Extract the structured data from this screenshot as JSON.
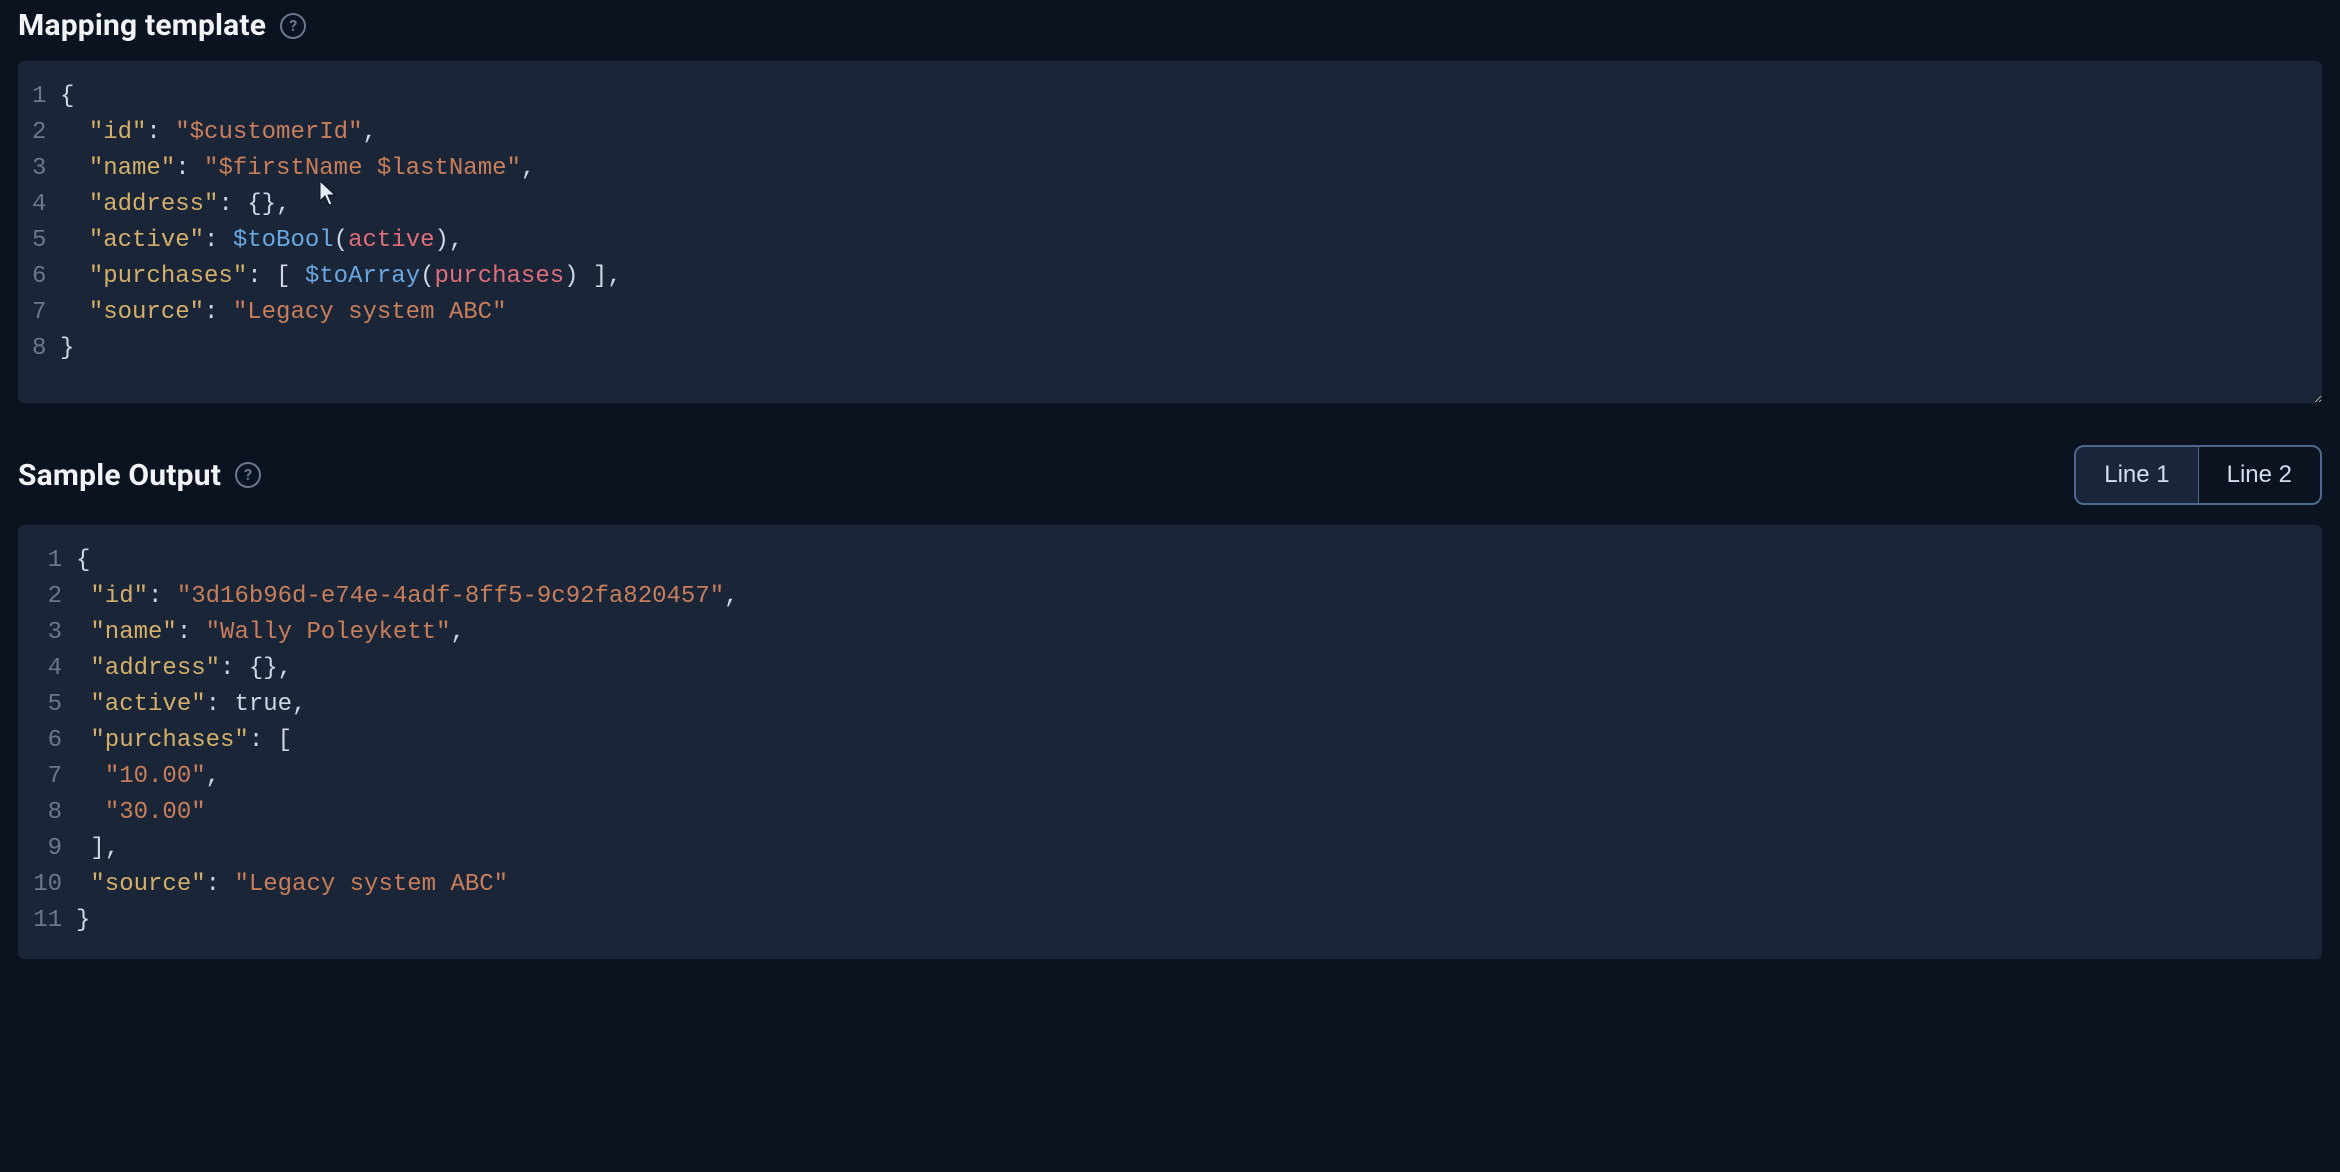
{
  "mappingTemplate": {
    "title": "Mapping template",
    "lines": [
      {
        "n": "1",
        "tokens": [
          {
            "t": "{",
            "c": "punc"
          }
        ]
      },
      {
        "n": "2",
        "tokens": [
          {
            "t": "  ",
            "c": "plain"
          },
          {
            "t": "\"id\"",
            "c": "key"
          },
          {
            "t": ": ",
            "c": "punc"
          },
          {
            "t": "\"$customerId\"",
            "c": "str"
          },
          {
            "t": ",",
            "c": "punc"
          }
        ]
      },
      {
        "n": "3",
        "tokens": [
          {
            "t": "  ",
            "c": "plain"
          },
          {
            "t": "\"name\"",
            "c": "key"
          },
          {
            "t": ": ",
            "c": "punc"
          },
          {
            "t": "\"$firstName $lastName\"",
            "c": "str"
          },
          {
            "t": ",",
            "c": "punc"
          }
        ]
      },
      {
        "n": "4",
        "tokens": [
          {
            "t": "  ",
            "c": "plain"
          },
          {
            "t": "\"address\"",
            "c": "key"
          },
          {
            "t": ": ",
            "c": "punc"
          },
          {
            "t": "{}",
            "c": "punc"
          },
          {
            "t": ",",
            "c": "punc"
          }
        ]
      },
      {
        "n": "5",
        "tokens": [
          {
            "t": "  ",
            "c": "plain"
          },
          {
            "t": "\"active\"",
            "c": "key"
          },
          {
            "t": ": ",
            "c": "punc"
          },
          {
            "t": "$toBool",
            "c": "func"
          },
          {
            "t": "(",
            "c": "punc"
          },
          {
            "t": "active",
            "c": "var"
          },
          {
            "t": ")",
            "c": "punc"
          },
          {
            "t": ",",
            "c": "punc"
          }
        ]
      },
      {
        "n": "6",
        "tokens": [
          {
            "t": "  ",
            "c": "plain"
          },
          {
            "t": "\"purchases\"",
            "c": "key"
          },
          {
            "t": ": ",
            "c": "punc"
          },
          {
            "t": "[ ",
            "c": "punc"
          },
          {
            "t": "$toArray",
            "c": "func"
          },
          {
            "t": "(",
            "c": "punc"
          },
          {
            "t": "purchases",
            "c": "var"
          },
          {
            "t": ")",
            "c": "punc"
          },
          {
            "t": " ]",
            "c": "punc"
          },
          {
            "t": ",",
            "c": "punc"
          }
        ]
      },
      {
        "n": "7",
        "tokens": [
          {
            "t": "  ",
            "c": "plain"
          },
          {
            "t": "\"source\"",
            "c": "key"
          },
          {
            "t": ": ",
            "c": "punc"
          },
          {
            "t": "\"Legacy system ABC\"",
            "c": "str"
          }
        ]
      },
      {
        "n": "8",
        "tokens": [
          {
            "t": "}",
            "c": "punc"
          }
        ]
      }
    ]
  },
  "sampleOutput": {
    "title": "Sample Output",
    "tabs": [
      {
        "label": "Line 1",
        "active": true
      },
      {
        "label": "Line 2",
        "active": false
      }
    ],
    "lines": [
      {
        "n": "1",
        "tokens": [
          {
            "t": "{",
            "c": "punc"
          }
        ]
      },
      {
        "n": "2",
        "tokens": [
          {
            "t": " ",
            "c": "plain"
          },
          {
            "t": "\"id\"",
            "c": "key"
          },
          {
            "t": ": ",
            "c": "punc"
          },
          {
            "t": "\"3d16b96d-e74e-4adf-8ff5-9c92fa820457\"",
            "c": "str"
          },
          {
            "t": ",",
            "c": "punc"
          }
        ]
      },
      {
        "n": "3",
        "tokens": [
          {
            "t": " ",
            "c": "plain"
          },
          {
            "t": "\"name\"",
            "c": "key"
          },
          {
            "t": ": ",
            "c": "punc"
          },
          {
            "t": "\"Wally Poleykett\"",
            "c": "str"
          },
          {
            "t": ",",
            "c": "punc"
          }
        ]
      },
      {
        "n": "4",
        "tokens": [
          {
            "t": " ",
            "c": "plain"
          },
          {
            "t": "\"address\"",
            "c": "key"
          },
          {
            "t": ": ",
            "c": "punc"
          },
          {
            "t": "{}",
            "c": "punc"
          },
          {
            "t": ",",
            "c": "punc"
          }
        ]
      },
      {
        "n": "5",
        "tokens": [
          {
            "t": " ",
            "c": "plain"
          },
          {
            "t": "\"active\"",
            "c": "key"
          },
          {
            "t": ": ",
            "c": "punc"
          },
          {
            "t": "true",
            "c": "bool"
          },
          {
            "t": ",",
            "c": "punc"
          }
        ]
      },
      {
        "n": "6",
        "tokens": [
          {
            "t": " ",
            "c": "plain"
          },
          {
            "t": "\"purchases\"",
            "c": "key"
          },
          {
            "t": ": ",
            "c": "punc"
          },
          {
            "t": "[",
            "c": "punc"
          }
        ]
      },
      {
        "n": "7",
        "tokens": [
          {
            "t": "  ",
            "c": "plain"
          },
          {
            "t": "\"10.00\"",
            "c": "str"
          },
          {
            "t": ",",
            "c": "punc"
          }
        ]
      },
      {
        "n": "8",
        "tokens": [
          {
            "t": "  ",
            "c": "plain"
          },
          {
            "t": "\"30.00\"",
            "c": "str"
          }
        ]
      },
      {
        "n": "9",
        "tokens": [
          {
            "t": " ",
            "c": "plain"
          },
          {
            "t": "]",
            "c": "punc"
          },
          {
            "t": ",",
            "c": "punc"
          }
        ]
      },
      {
        "n": "10",
        "tokens": [
          {
            "t": " ",
            "c": "plain"
          },
          {
            "t": "\"source\"",
            "c": "key"
          },
          {
            "t": ": ",
            "c": "punc"
          },
          {
            "t": "\"Legacy system ABC\"",
            "c": "str"
          }
        ]
      },
      {
        "n": "11",
        "tokens": [
          {
            "t": "}",
            "c": "punc"
          }
        ]
      }
    ]
  },
  "help_glyph": "?"
}
